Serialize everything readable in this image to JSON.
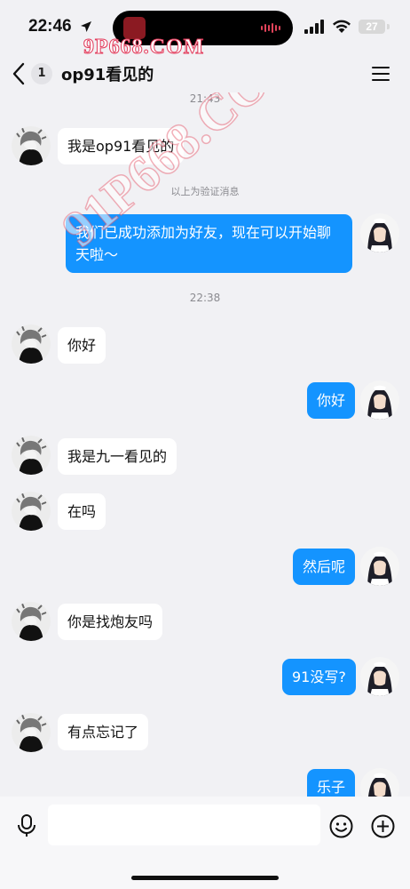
{
  "status_bar": {
    "time": "22:46",
    "battery": "27",
    "watermark": "9P668.COM"
  },
  "nav": {
    "unread_count": "1",
    "title": "op91看见的"
  },
  "watermark_diagonal": "91P668.COM",
  "messages": [
    {
      "kind": "time",
      "text": "21:43"
    },
    {
      "kind": "in",
      "text": "我是op91看见的"
    },
    {
      "kind": "system",
      "text": "以上为验证消息"
    },
    {
      "kind": "out",
      "text": "我们已成功添加为好友，现在可以开始聊天啦～"
    },
    {
      "kind": "time",
      "text": "22:38"
    },
    {
      "kind": "in",
      "text": "你好"
    },
    {
      "kind": "out",
      "text": "你好"
    },
    {
      "kind": "in",
      "text": "我是九一看见的"
    },
    {
      "kind": "in",
      "text": "在吗"
    },
    {
      "kind": "out",
      "text": "然后呢"
    },
    {
      "kind": "in",
      "text": "你是找炮友吗"
    },
    {
      "kind": "out",
      "text": "91没写?"
    },
    {
      "kind": "in",
      "text": "有点忘记了"
    },
    {
      "kind": "out",
      "text": "乐子"
    }
  ],
  "input": {
    "value": "",
    "placeholder": ""
  },
  "icons": {
    "back": "chevron-left-icon",
    "menu": "hamburger-menu-icon",
    "mic": "microphone-icon",
    "emoji": "smiley-icon",
    "plus": "plus-circle-icon"
  },
  "colors": {
    "accent": "#1494ff",
    "background": "#f1f1f4",
    "bubble_in": "#ffffff"
  }
}
